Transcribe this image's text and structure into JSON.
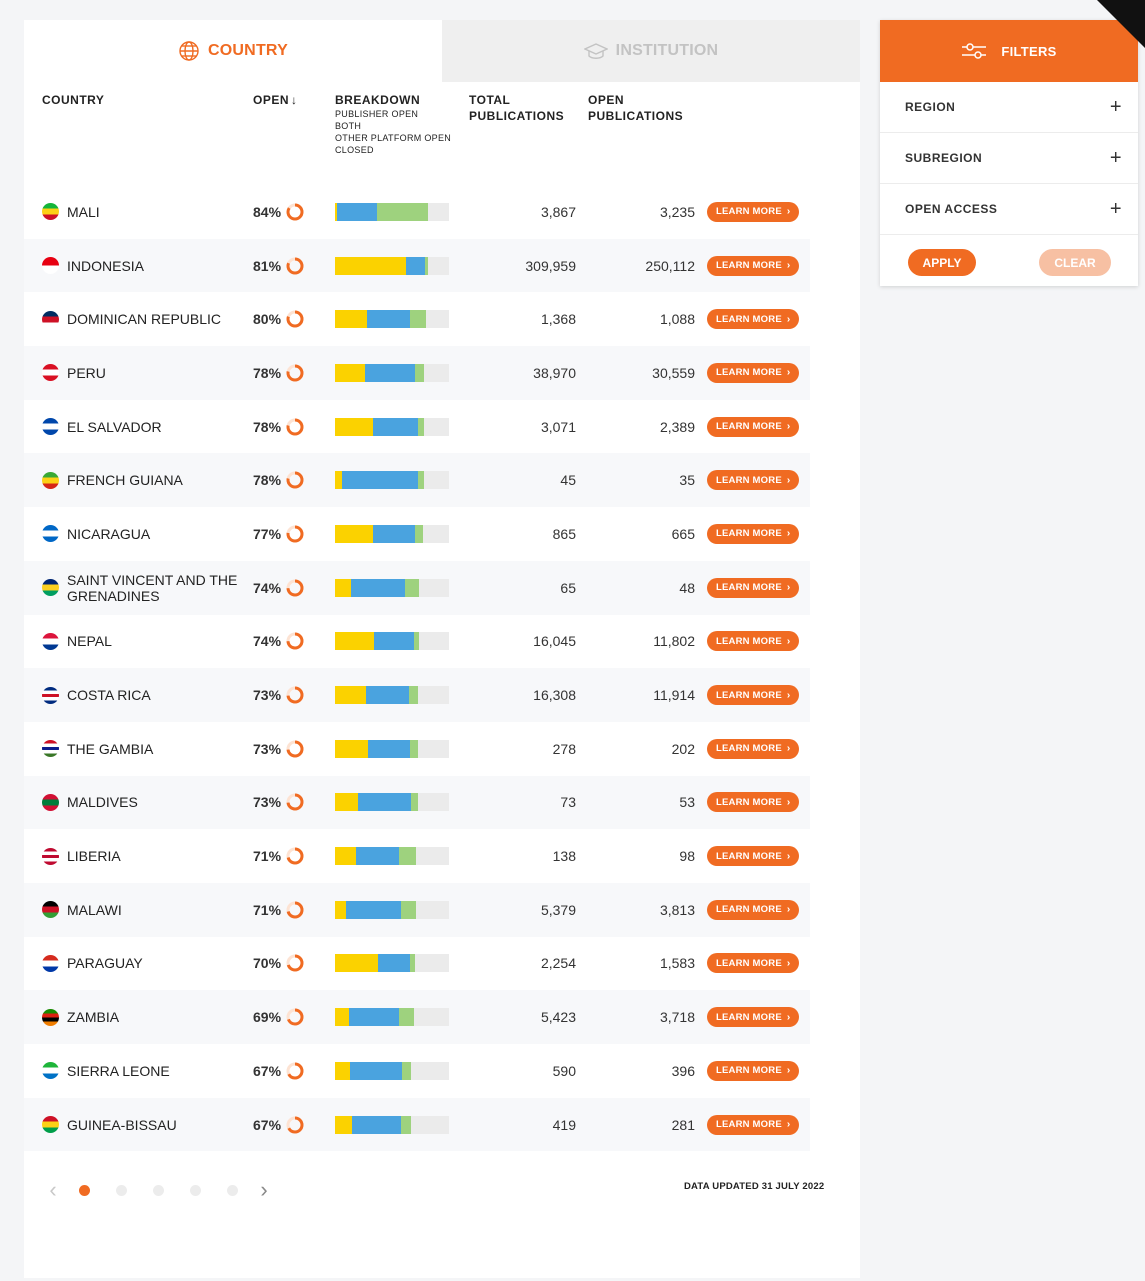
{
  "tabs": {
    "country": "COUNTRY",
    "institution": "INSTITUTION"
  },
  "headers": {
    "country": "COUNTRY",
    "open": "OPEN",
    "open_arrow": "↓",
    "breakdown": "BREAKDOWN",
    "breakdown_legend": [
      "PUBLISHER OPEN",
      "BOTH",
      "OTHER PLATFORM OPEN",
      "CLOSED"
    ],
    "total": [
      "TOTAL",
      "PUBLICATIONS"
    ],
    "open_pubs": [
      "OPEN",
      "PUBLICATIONS"
    ]
  },
  "colors": {
    "accent": "#f06b22",
    "publisher_open": "#fbd200",
    "both": "#4aa3df",
    "other_platform_open": "#9ed27e",
    "closed": "#ebebeb"
  },
  "learn_more_label": "LEARN MORE",
  "rows": [
    {
      "country": "MALI",
      "flag": [
        "#14b53a",
        "#fcd116",
        "#ce1126"
      ],
      "open": "84%",
      "open_fraction": 0.84,
      "breakdown": [
        0.02,
        0.35,
        0.45
      ],
      "total": "3,867",
      "open_pubs": "3,235"
    },
    {
      "country": "INDONESIA",
      "flag": [
        "#e70011",
        "#ffffff"
      ],
      "open": "81%",
      "open_fraction": 0.81,
      "breakdown": [
        0.62,
        0.17,
        0.03
      ],
      "total": "309,959",
      "open_pubs": "250,112"
    },
    {
      "country": "DOMINICAN REPUBLIC",
      "flag": [
        "#002d62",
        "#ce1126",
        "#ffffff"
      ],
      "open": "80%",
      "open_fraction": 0.8,
      "breakdown": [
        0.28,
        0.38,
        0.14
      ],
      "total": "1,368",
      "open_pubs": "1,088"
    },
    {
      "country": "PERU",
      "flag": [
        "#d91023",
        "#ffffff",
        "#d91023"
      ],
      "open": "78%",
      "open_fraction": 0.78,
      "breakdown": [
        0.26,
        0.44,
        0.08
      ],
      "total": "38,970",
      "open_pubs": "30,559"
    },
    {
      "country": "EL SALVADOR",
      "flag": [
        "#0047ab",
        "#ffffff",
        "#0047ab"
      ],
      "open": "78%",
      "open_fraction": 0.78,
      "breakdown": [
        0.33,
        0.4,
        0.05
      ],
      "total": "3,071",
      "open_pubs": "2,389"
    },
    {
      "country": "FRENCH GUIANA",
      "flag": [
        "#3aa935",
        "#fcd116",
        "#d62718"
      ],
      "open": "78%",
      "open_fraction": 0.78,
      "breakdown": [
        0.06,
        0.67,
        0.05
      ],
      "total": "45",
      "open_pubs": "35"
    },
    {
      "country": "NICARAGUA",
      "flag": [
        "#0067c6",
        "#ffffff",
        "#0067c6"
      ],
      "open": "77%",
      "open_fraction": 0.77,
      "breakdown": [
        0.33,
        0.37,
        0.07
      ],
      "total": "865",
      "open_pubs": "665"
    },
    {
      "country": "SAINT VINCENT AND THE GRENADINES",
      "flag": [
        "#002674",
        "#fcd022",
        "#009e60"
      ],
      "open": "74%",
      "open_fraction": 0.74,
      "breakdown": [
        0.14,
        0.47,
        0.13
      ],
      "total": "65",
      "open_pubs": "48"
    },
    {
      "country": "NEPAL",
      "flag": [
        "#dc143c",
        "#ffffff",
        "#003893"
      ],
      "open": "74%",
      "open_fraction": 0.74,
      "breakdown": [
        0.34,
        0.35,
        0.05
      ],
      "total": "16,045",
      "open_pubs": "11,802"
    },
    {
      "country": "COSTA RICA",
      "flag": [
        "#002b7f",
        "#ffffff",
        "#ce1126",
        "#ffffff",
        "#002b7f"
      ],
      "open": "73%",
      "open_fraction": 0.73,
      "breakdown": [
        0.27,
        0.38,
        0.08
      ],
      "total": "16,308",
      "open_pubs": "11,914"
    },
    {
      "country": "THE GAMBIA",
      "flag": [
        "#ce1126",
        "#ffffff",
        "#0c1c8c",
        "#ffffff",
        "#3a7728"
      ],
      "open": "73%",
      "open_fraction": 0.73,
      "breakdown": [
        0.29,
        0.37,
        0.07
      ],
      "total": "278",
      "open_pubs": "202"
    },
    {
      "country": "MALDIVES",
      "flag": [
        "#d21034",
        "#007e3a",
        "#d21034"
      ],
      "open": "73%",
      "open_fraction": 0.73,
      "breakdown": [
        0.2,
        0.47,
        0.06
      ],
      "total": "73",
      "open_pubs": "53"
    },
    {
      "country": "LIBERIA",
      "flag": [
        "#bf0a30",
        "#ffffff",
        "#bf0a30",
        "#ffffff",
        "#bf0a30"
      ],
      "open": "71%",
      "open_fraction": 0.71,
      "breakdown": [
        0.18,
        0.38,
        0.15
      ],
      "total": "138",
      "open_pubs": "98"
    },
    {
      "country": "MALAWI",
      "flag": [
        "#000000",
        "#ce1126",
        "#339e35"
      ],
      "open": "71%",
      "open_fraction": 0.71,
      "breakdown": [
        0.1,
        0.48,
        0.13
      ],
      "total": "5,379",
      "open_pubs": "3,813"
    },
    {
      "country": "PARAGUAY",
      "flag": [
        "#d52b1e",
        "#ffffff",
        "#0038a8"
      ],
      "open": "70%",
      "open_fraction": 0.7,
      "breakdown": [
        0.38,
        0.28,
        0.04
      ],
      "total": "2,254",
      "open_pubs": "1,583"
    },
    {
      "country": "ZAMBIA",
      "flag": [
        "#198a00",
        "#de2010",
        "#000000",
        "#ef7d00"
      ],
      "open": "69%",
      "open_fraction": 0.69,
      "breakdown": [
        0.12,
        0.44,
        0.13
      ],
      "total": "5,423",
      "open_pubs": "3,718"
    },
    {
      "country": "SIERRA LEONE",
      "flag": [
        "#1eb53a",
        "#ffffff",
        "#0072c6"
      ],
      "open": "67%",
      "open_fraction": 0.67,
      "breakdown": [
        0.13,
        0.46,
        0.08
      ],
      "total": "590",
      "open_pubs": "396"
    },
    {
      "country": "GUINEA-BISSAU",
      "flag": [
        "#ce1126",
        "#fcd116",
        "#009e49"
      ],
      "open": "67%",
      "open_fraction": 0.67,
      "breakdown": [
        0.15,
        0.43,
        0.09
      ],
      "total": "419",
      "open_pubs": "281"
    }
  ],
  "pagination": {
    "pages": 5,
    "current": 1
  },
  "updated": "DATA UPDATED 31 JULY 2022",
  "filters": {
    "title": "FILTERS",
    "items": [
      "REGION",
      "SUBREGION",
      "OPEN ACCESS"
    ],
    "apply": "APPLY",
    "clear": "CLEAR"
  }
}
